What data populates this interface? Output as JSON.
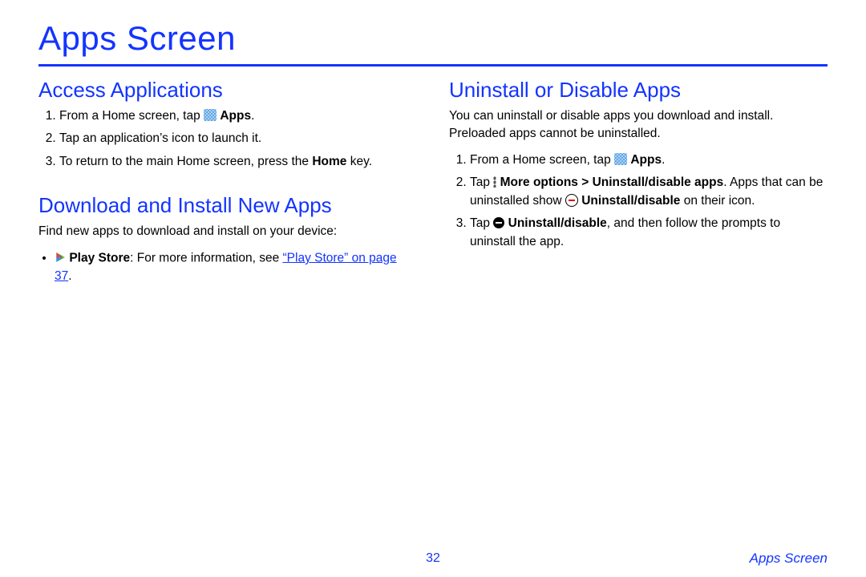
{
  "title": "Apps Screen",
  "footer": {
    "page": "32",
    "caption": "Apps Screen"
  },
  "left": {
    "sec1": {
      "heading": "Access Applications",
      "step1_a": "From a Home screen, tap ",
      "step1_b": "Apps",
      "step1_c": ".",
      "step2": "Tap an application’s icon to launch it.",
      "step3_a": "To return to the main Home screen, press the ",
      "step3_b": "Home",
      "step3_c": " key."
    },
    "sec2": {
      "heading": "Download and Install New Apps",
      "intro": "Find new apps to download and install on your device:",
      "bullet_b1": "Play Store",
      "bullet_t1": ": For more information, see ",
      "bullet_link": "“Play Store” on page 37",
      "bullet_t2": "."
    }
  },
  "right": {
    "sec1": {
      "heading": "Uninstall or Disable Apps",
      "intro": "You can uninstall or disable apps you download and install. Preloaded apps cannot be uninstalled.",
      "step1_a": "From a Home screen, tap ",
      "step1_b": "Apps",
      "step1_c": ".",
      "step2_a": "Tap ",
      "step2_b": "More options > Uninstall/disable apps",
      "step2_c": ". Apps that can be uninstalled show ",
      "step2_d": "Uninstall/disable",
      "step2_e": " on their icon.",
      "step3_a": "Tap ",
      "step3_b": "Uninstall/disable",
      "step3_c": ", and then follow the prompts to uninstall the app."
    }
  }
}
